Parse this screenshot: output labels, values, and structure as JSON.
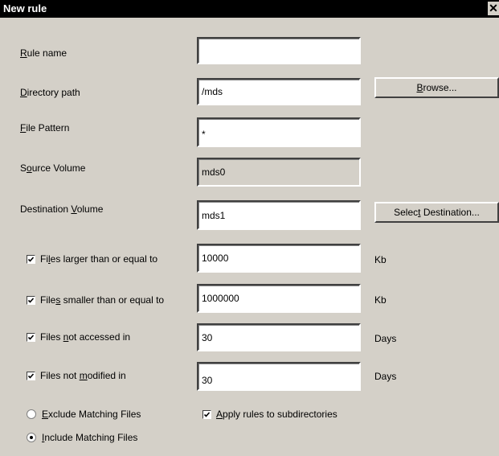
{
  "window": {
    "title": "New rule",
    "close_glyph": "✕"
  },
  "form": {
    "rule_name": {
      "label_pre": "",
      "label_key": "R",
      "label_post": "ule name",
      "value": ""
    },
    "directory_path": {
      "label_pre": "",
      "label_key": "D",
      "label_post": "irectory path",
      "value": "/mds",
      "button_pre": "",
      "button_key": "B",
      "button_post": "rowse..."
    },
    "file_pattern": {
      "label_pre": "",
      "label_key": "F",
      "label_post": "ile Pattern",
      "value": "*"
    },
    "source_volume": {
      "label_pre": "S",
      "label_key": "o",
      "label_post": "urce Volume",
      "value": "mds0"
    },
    "destination_volume": {
      "label_pre": "Destination ",
      "label_key": "V",
      "label_post": "olume",
      "value": "mds1",
      "button_pre": "Selec",
      "button_key": "t",
      "button_post": " Destination..."
    }
  },
  "filters": [
    {
      "label_pre": "Fi",
      "label_key": "l",
      "label_post": "es larger than or equal to",
      "checked": true,
      "value": "10000",
      "unit": "Kb"
    },
    {
      "label_pre": "File",
      "label_key": "s",
      "label_post": " smaller than or equal to",
      "checked": true,
      "value": "1000000",
      "unit": "Kb"
    },
    {
      "label_pre": "Files ",
      "label_key": "n",
      "label_post": "ot accessed in",
      "checked": true,
      "value": "30",
      "unit": "Days"
    },
    {
      "label_pre": "Files not ",
      "label_key": "m",
      "label_post": "odified in",
      "checked": true,
      "value": "30",
      "unit": "Days"
    }
  ],
  "options": {
    "exclude": {
      "label_pre": "",
      "label_key": "E",
      "label_post": "xclude Matching Files",
      "selected": false
    },
    "include": {
      "label_pre": "",
      "label_key": "I",
      "label_post": "nclude Matching Files",
      "selected": true
    },
    "subdirs": {
      "label_pre": "",
      "label_key": "A",
      "label_post": "pply rules to subdirectories",
      "checked": true
    }
  }
}
